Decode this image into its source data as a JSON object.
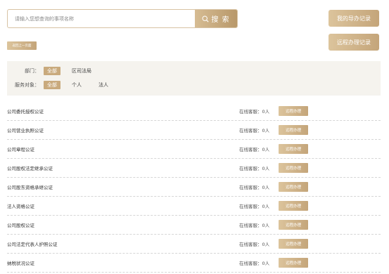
{
  "search": {
    "placeholder": "请输入您想查询的事项名称",
    "button_label": "搜 索"
  },
  "side_buttons": {
    "guide_records": "我的导办记录",
    "remote_records": "远程办理记录"
  },
  "back_label": "返回上一页面",
  "filters": {
    "department": {
      "label": "部门：",
      "options": [
        "全部",
        "区司法局"
      ],
      "selected": "全部"
    },
    "audience": {
      "label": "服务对象：",
      "options": [
        "全部",
        "个人",
        "法人"
      ],
      "selected": "全部"
    }
  },
  "items": [
    {
      "name": "公司委托授权公证",
      "status_label": "在线客服：",
      "status_value": "0人",
      "action": "远程办理"
    },
    {
      "name": "公司营业执照公证",
      "status_label": "在线客服：",
      "status_value": "0人",
      "action": "远程办理"
    },
    {
      "name": "公司章程公证",
      "status_label": "在线客服：",
      "status_value": "0人",
      "action": "远程办理"
    },
    {
      "name": "公司股权法定继承公证",
      "status_label": "在线客服：",
      "status_value": "0人",
      "action": "远程办理"
    },
    {
      "name": "公司股东资格承继公证",
      "status_label": "在线客服：",
      "status_value": "0人",
      "action": "远程办理"
    },
    {
      "name": "法人资格公证",
      "status_label": "在线客服：",
      "status_value": "0人",
      "action": "远程办理"
    },
    {
      "name": "公司股权公证",
      "status_label": "在线客服：",
      "status_value": "0人",
      "action": "远程办理"
    },
    {
      "name": "公司法定代表人护照公证",
      "status_label": "在线客服：",
      "status_value": "0人",
      "action": "远程办理"
    },
    {
      "name": "纳税状况公证",
      "status_label": "在线客服：",
      "status_value": "0人",
      "action": "远程办理"
    }
  ],
  "colors": {
    "accent": "#c9aa7d",
    "accent_dark": "#b8986a",
    "panel_bg": "#f5f3ee"
  }
}
